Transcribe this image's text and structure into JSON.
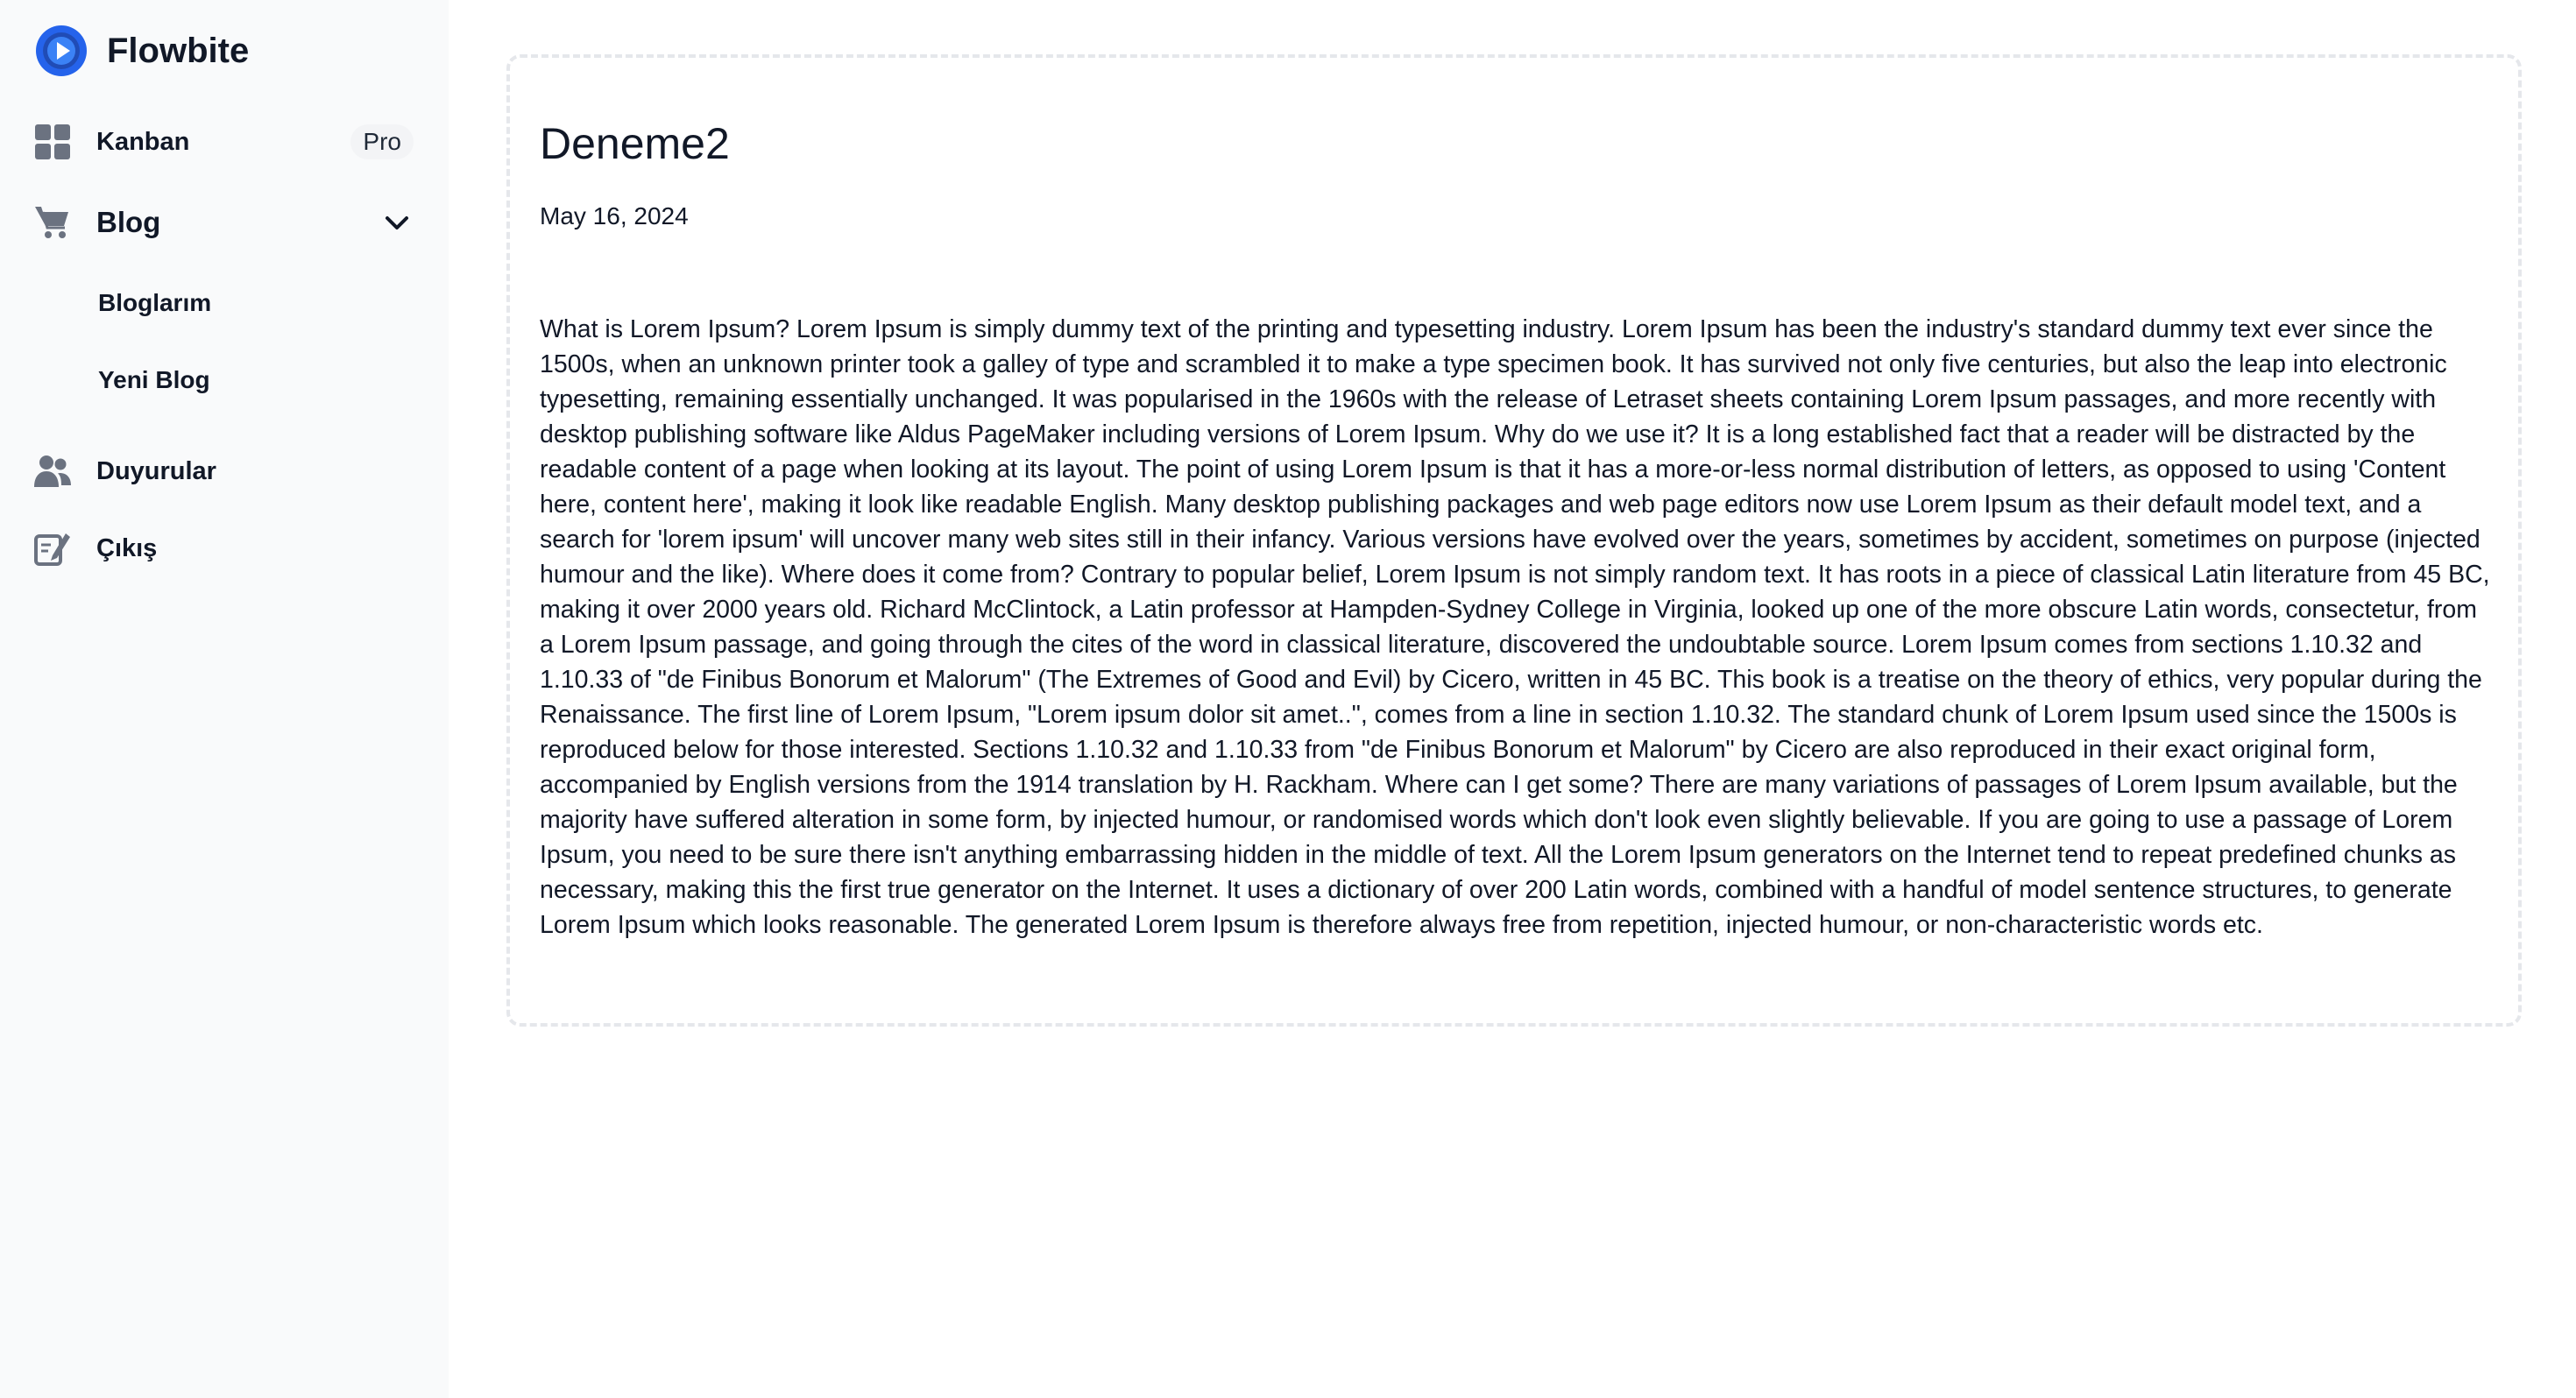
{
  "sidebar": {
    "brand": {
      "name": "Flowbite",
      "logo_icon": "play-circle-logo",
      "logo_color": "#2563eb"
    },
    "items": [
      {
        "label": "Kanban",
        "icon": "grid-icon",
        "badge": "Pro"
      },
      {
        "label": "Blog",
        "icon": "cart-icon",
        "expanded": true,
        "children": [
          {
            "label": "Bloglarım"
          },
          {
            "label": "Yeni Blog"
          }
        ]
      },
      {
        "label": "Duyurular",
        "icon": "users-icon"
      },
      {
        "label": "Çıkış",
        "icon": "edit-icon"
      }
    ]
  },
  "main": {
    "title": "Deneme2",
    "date": "May 16, 2024",
    "body": "What is Lorem Ipsum? Lorem Ipsum is simply dummy text of the printing and typesetting industry. Lorem Ipsum has been the industry's standard dummy text ever since the 1500s, when an unknown printer took a galley of type and scrambled it to make a type specimen book. It has survived not only five centuries, but also the leap into electronic typesetting, remaining essentially unchanged. It was popularised in the 1960s with the release of Letraset sheets containing Lorem Ipsum passages, and more recently with desktop publishing software like Aldus PageMaker including versions of Lorem Ipsum. Why do we use it? It is a long established fact that a reader will be distracted by the readable content of a page when looking at its layout. The point of using Lorem Ipsum is that it has a more-or-less normal distribution of letters, as opposed to using 'Content here, content here', making it look like readable English. Many desktop publishing packages and web page editors now use Lorem Ipsum as their default model text, and a search for 'lorem ipsum' will uncover many web sites still in their infancy. Various versions have evolved over the years, sometimes by accident, sometimes on purpose (injected humour and the like). Where does it come from? Contrary to popular belief, Lorem Ipsum is not simply random text. It has roots in a piece of classical Latin literature from 45 BC, making it over 2000 years old. Richard McClintock, a Latin professor at Hampden-Sydney College in Virginia, looked up one of the more obscure Latin words, consectetur, from a Lorem Ipsum passage, and going through the cites of the word in classical literature, discovered the undoubtable source. Lorem Ipsum comes from sections 1.10.32 and 1.10.33 of \"de Finibus Bonorum et Malorum\" (The Extremes of Good and Evil) by Cicero, written in 45 BC. This book is a treatise on the theory of ethics, very popular during the Renaissance. The first line of Lorem Ipsum, \"Lorem ipsum dolor sit amet..\", comes from a line in section 1.10.32. The standard chunk of Lorem Ipsum used since the 1500s is reproduced below for those interested. Sections 1.10.32 and 1.10.33 from \"de Finibus Bonorum et Malorum\" by Cicero are also reproduced in their exact original form, accompanied by English versions from the 1914 translation by H. Rackham. Where can I get some? There are many variations of passages of Lorem Ipsum available, but the majority have suffered alteration in some form, by injected humour, or randomised words which don't look even slightly believable. If you are going to use a passage of Lorem Ipsum, you need to be sure there isn't anything embarrassing hidden in the middle of text. All the Lorem Ipsum generators on the Internet tend to repeat predefined chunks as necessary, making this the first true generator on the Internet. It uses a dictionary of over 200 Latin words, combined with a handful of model sentence structures, to generate Lorem Ipsum which looks reasonable. The generated Lorem Ipsum is therefore always free from repetition, injected humour, or non-characteristic words etc."
  }
}
